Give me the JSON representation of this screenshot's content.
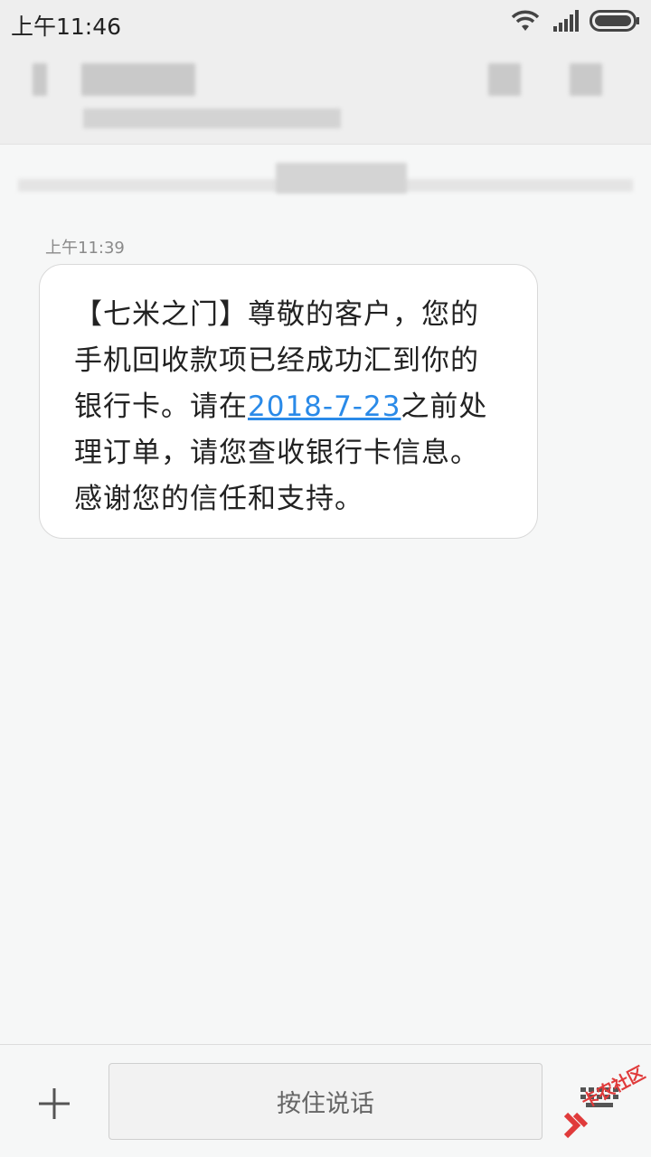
{
  "status_bar": {
    "time": "上午11:46",
    "icons": [
      "wifi-icon",
      "signal-icon",
      "battery-icon"
    ]
  },
  "header": {
    "contact_name": "",
    "contact_number": ""
  },
  "message": {
    "time": "上午11:39",
    "text_before_link": "【七米之门】尊敬的客户，您的手机回收款项已经成功汇到你的银行卡。请在",
    "link_text": "2018-7-23",
    "text_after_link": "之前处理订单，请您查收银行卡信息。感谢您的信任和支持。"
  },
  "input_bar": {
    "voice_label": "按住说话"
  },
  "watermark": {
    "text": "卡农社区"
  },
  "colors": {
    "link": "#2a8ae8",
    "background": "#f6f7f7",
    "bubble": "#ffffff",
    "watermark": "#e03b3b"
  }
}
